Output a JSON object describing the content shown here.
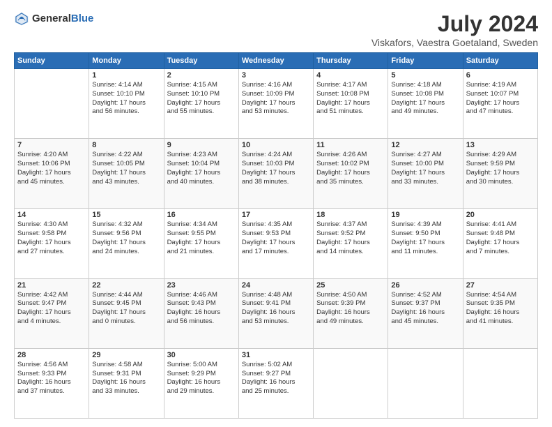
{
  "logo": {
    "general": "General",
    "blue": "Blue"
  },
  "title": {
    "month_year": "July 2024",
    "location": "Viskafors, Vaestra Goetaland, Sweden"
  },
  "days_of_week": [
    "Sunday",
    "Monday",
    "Tuesday",
    "Wednesday",
    "Thursday",
    "Friday",
    "Saturday"
  ],
  "weeks": [
    [
      {
        "day": "",
        "detail": ""
      },
      {
        "day": "1",
        "detail": "Sunrise: 4:14 AM\nSunset: 10:10 PM\nDaylight: 17 hours\nand 56 minutes."
      },
      {
        "day": "2",
        "detail": "Sunrise: 4:15 AM\nSunset: 10:10 PM\nDaylight: 17 hours\nand 55 minutes."
      },
      {
        "day": "3",
        "detail": "Sunrise: 4:16 AM\nSunset: 10:09 PM\nDaylight: 17 hours\nand 53 minutes."
      },
      {
        "day": "4",
        "detail": "Sunrise: 4:17 AM\nSunset: 10:08 PM\nDaylight: 17 hours\nand 51 minutes."
      },
      {
        "day": "5",
        "detail": "Sunrise: 4:18 AM\nSunset: 10:08 PM\nDaylight: 17 hours\nand 49 minutes."
      },
      {
        "day": "6",
        "detail": "Sunrise: 4:19 AM\nSunset: 10:07 PM\nDaylight: 17 hours\nand 47 minutes."
      }
    ],
    [
      {
        "day": "7",
        "detail": "Sunrise: 4:20 AM\nSunset: 10:06 PM\nDaylight: 17 hours\nand 45 minutes."
      },
      {
        "day": "8",
        "detail": "Sunrise: 4:22 AM\nSunset: 10:05 PM\nDaylight: 17 hours\nand 43 minutes."
      },
      {
        "day": "9",
        "detail": "Sunrise: 4:23 AM\nSunset: 10:04 PM\nDaylight: 17 hours\nand 40 minutes."
      },
      {
        "day": "10",
        "detail": "Sunrise: 4:24 AM\nSunset: 10:03 PM\nDaylight: 17 hours\nand 38 minutes."
      },
      {
        "day": "11",
        "detail": "Sunrise: 4:26 AM\nSunset: 10:02 PM\nDaylight: 17 hours\nand 35 minutes."
      },
      {
        "day": "12",
        "detail": "Sunrise: 4:27 AM\nSunset: 10:00 PM\nDaylight: 17 hours\nand 33 minutes."
      },
      {
        "day": "13",
        "detail": "Sunrise: 4:29 AM\nSunset: 9:59 PM\nDaylight: 17 hours\nand 30 minutes."
      }
    ],
    [
      {
        "day": "14",
        "detail": "Sunrise: 4:30 AM\nSunset: 9:58 PM\nDaylight: 17 hours\nand 27 minutes."
      },
      {
        "day": "15",
        "detail": "Sunrise: 4:32 AM\nSunset: 9:56 PM\nDaylight: 17 hours\nand 24 minutes."
      },
      {
        "day": "16",
        "detail": "Sunrise: 4:34 AM\nSunset: 9:55 PM\nDaylight: 17 hours\nand 21 minutes."
      },
      {
        "day": "17",
        "detail": "Sunrise: 4:35 AM\nSunset: 9:53 PM\nDaylight: 17 hours\nand 17 minutes."
      },
      {
        "day": "18",
        "detail": "Sunrise: 4:37 AM\nSunset: 9:52 PM\nDaylight: 17 hours\nand 14 minutes."
      },
      {
        "day": "19",
        "detail": "Sunrise: 4:39 AM\nSunset: 9:50 PM\nDaylight: 17 hours\nand 11 minutes."
      },
      {
        "day": "20",
        "detail": "Sunrise: 4:41 AM\nSunset: 9:48 PM\nDaylight: 17 hours\nand 7 minutes."
      }
    ],
    [
      {
        "day": "21",
        "detail": "Sunrise: 4:42 AM\nSunset: 9:47 PM\nDaylight: 17 hours\nand 4 minutes."
      },
      {
        "day": "22",
        "detail": "Sunrise: 4:44 AM\nSunset: 9:45 PM\nDaylight: 17 hours\nand 0 minutes."
      },
      {
        "day": "23",
        "detail": "Sunrise: 4:46 AM\nSunset: 9:43 PM\nDaylight: 16 hours\nand 56 minutes."
      },
      {
        "day": "24",
        "detail": "Sunrise: 4:48 AM\nSunset: 9:41 PM\nDaylight: 16 hours\nand 53 minutes."
      },
      {
        "day": "25",
        "detail": "Sunrise: 4:50 AM\nSunset: 9:39 PM\nDaylight: 16 hours\nand 49 minutes."
      },
      {
        "day": "26",
        "detail": "Sunrise: 4:52 AM\nSunset: 9:37 PM\nDaylight: 16 hours\nand 45 minutes."
      },
      {
        "day": "27",
        "detail": "Sunrise: 4:54 AM\nSunset: 9:35 PM\nDaylight: 16 hours\nand 41 minutes."
      }
    ],
    [
      {
        "day": "28",
        "detail": "Sunrise: 4:56 AM\nSunset: 9:33 PM\nDaylight: 16 hours\nand 37 minutes."
      },
      {
        "day": "29",
        "detail": "Sunrise: 4:58 AM\nSunset: 9:31 PM\nDaylight: 16 hours\nand 33 minutes."
      },
      {
        "day": "30",
        "detail": "Sunrise: 5:00 AM\nSunset: 9:29 PM\nDaylight: 16 hours\nand 29 minutes."
      },
      {
        "day": "31",
        "detail": "Sunrise: 5:02 AM\nSunset: 9:27 PM\nDaylight: 16 hours\nand 25 minutes."
      },
      {
        "day": "",
        "detail": ""
      },
      {
        "day": "",
        "detail": ""
      },
      {
        "day": "",
        "detail": ""
      }
    ]
  ]
}
